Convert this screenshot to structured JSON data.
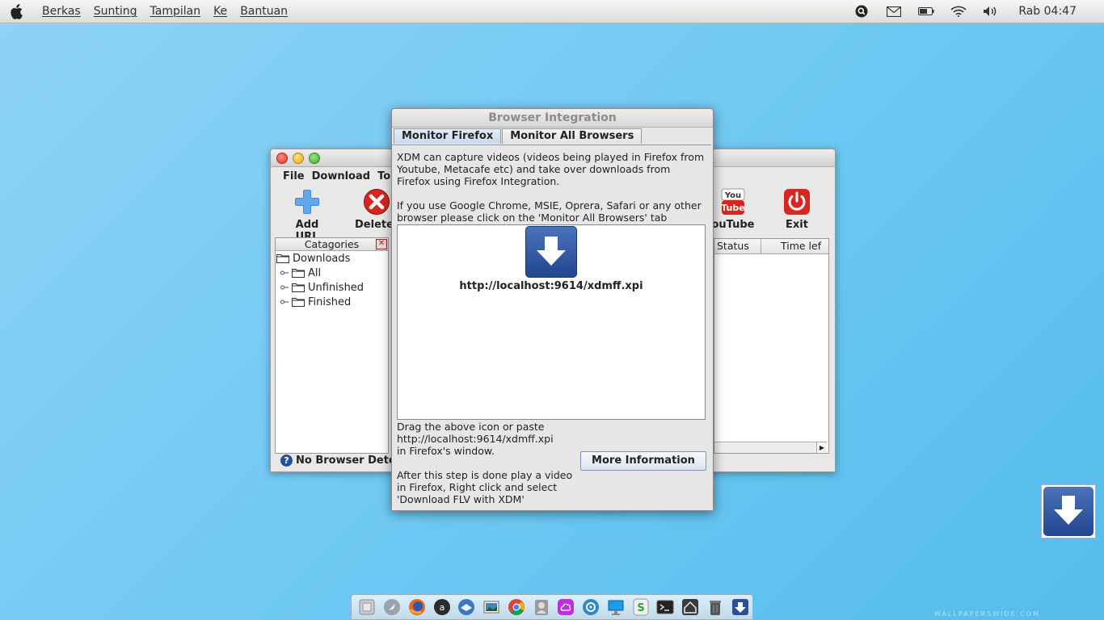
{
  "menubar": {
    "items": [
      "Berkas",
      "Sunting",
      "Tampilan",
      "Ke",
      "Bantuan"
    ],
    "clock": "Rab 04:47",
    "tray_icons": [
      "search-icon",
      "mail-icon",
      "battery-icon",
      "wifi-icon",
      "volume-icon"
    ]
  },
  "xdm": {
    "menu": [
      "File",
      "Download",
      "To"
    ],
    "toolbar": {
      "add_url": "Add URL",
      "delete": "Delete",
      "youtube": "ouTube",
      "exit": "Exit"
    },
    "categories": {
      "header": "Catagories",
      "close": "✕",
      "root": "Downloads",
      "items": [
        "All",
        "Unfinished",
        "Finished"
      ]
    },
    "table": {
      "columns": [
        "Status",
        "Time lef"
      ]
    },
    "status_text": "No Browser Dete"
  },
  "dialog": {
    "title": "Browser Integration",
    "tabs": [
      "Monitor Firefox",
      "Monitor All Browsers"
    ],
    "intro_lines": [
      "XDM can capture videos (videos being played in Firefox from",
      "Youtube, Metacafe etc) and take over downloads from",
      "Firefox using Firefox Integration."
    ],
    "other_lines": [
      "If you use Google Chrome, MSIE, Oprera, Safari or any other",
      "browser please click on the 'Monitor All Browsers' tab"
    ],
    "xpi_url": "http://localhost:9614/xdmff.xpi",
    "drag_lines": [
      "Drag the above icon or paste",
      "http://localhost:9614/xdmff.xpi",
      "in Firefox's window."
    ],
    "after_lines": [
      "After this step is done play a video",
      "in Firefox, Right click and select",
      "'Download FLV with XDM'"
    ],
    "more_info_button": "More Information"
  },
  "dock": {
    "icons": [
      "finder-icon",
      "launchpad-icon",
      "firefox-icon",
      "appstore-icon",
      "thunderbird-icon",
      "photos-icon",
      "chrome-icon",
      "contacts-icon",
      "icloud-icon",
      "settings-icon",
      "display-icon",
      "skype-icon",
      "terminal-icon",
      "home-icon",
      "trash-icon",
      "xdm-icon"
    ]
  },
  "watermark": "WALLPAPERSWIDE.COM"
}
